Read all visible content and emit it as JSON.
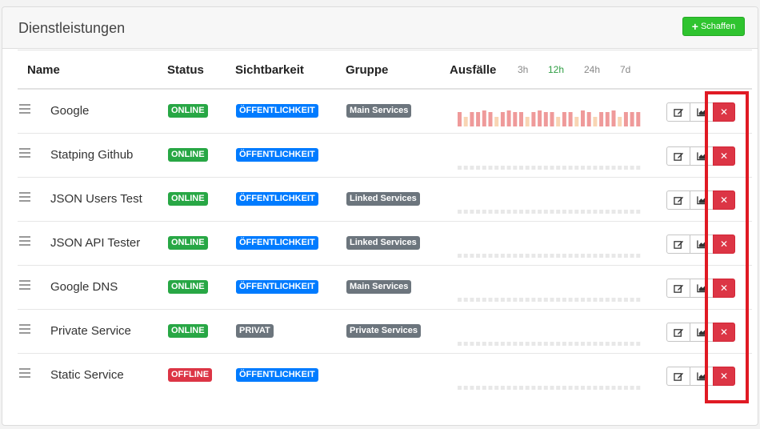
{
  "header": {
    "title": "Dienstleistungen",
    "create_label": "Schaffen"
  },
  "table": {
    "col_name": "Name",
    "col_status": "Status",
    "col_visibility": "Sichtbarkeit",
    "col_group": "Gruppe",
    "col_outages": "Ausfälle",
    "ranges": [
      "3h",
      "12h",
      "24h",
      "7d"
    ],
    "active_range": "12h"
  },
  "colors": {
    "online": "#28a745",
    "offline": "#dc3545",
    "public": "#007bff",
    "private": "#6c757d",
    "failure_bar": "#ef9a9a",
    "partial_bar": "#f8d5b4",
    "empty_bar": "#e8e8e8",
    "highlight": "#e01a24"
  },
  "rows": [
    {
      "name": "Google",
      "status": "ONLINE",
      "visibility": "ÖFFENTLICHKEIT",
      "group": "Main Services",
      "outages": "failures"
    },
    {
      "name": "Statping Github",
      "status": "ONLINE",
      "visibility": "ÖFFENTLICHKEIT",
      "group": "",
      "outages": "none"
    },
    {
      "name": "JSON Users Test",
      "status": "ONLINE",
      "visibility": "ÖFFENTLICHKEIT",
      "group": "Linked Services",
      "outages": "none"
    },
    {
      "name": "JSON API Tester",
      "status": "ONLINE",
      "visibility": "ÖFFENTLICHKEIT",
      "group": "Linked Services",
      "outages": "none"
    },
    {
      "name": "Google DNS",
      "status": "ONLINE",
      "visibility": "ÖFFENTLICHKEIT",
      "group": "Main Services",
      "outages": "none"
    },
    {
      "name": "Private Service",
      "status": "ONLINE",
      "visibility": "PRIVAT",
      "group": "Private Services",
      "outages": "none"
    },
    {
      "name": "Static Service",
      "status": "OFFLINE",
      "visibility": "ÖFFENTLICHKEIT",
      "group": "",
      "outages": "none"
    }
  ]
}
